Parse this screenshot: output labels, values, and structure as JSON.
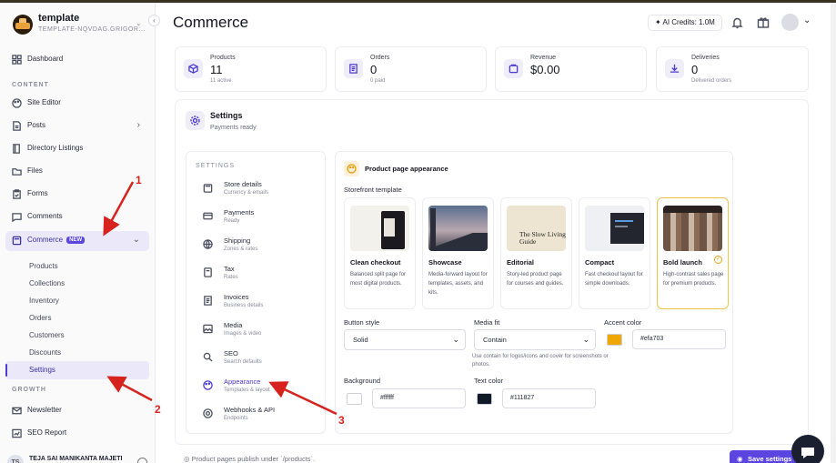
{
  "workspace": {
    "name": "template",
    "slug": "TEMPLATE-NQVDAG.GRIGOR..."
  },
  "sidebar": {
    "dashboard": "Dashboard",
    "section_content": "CONTENT",
    "site_editor": "Site Editor",
    "posts": "Posts",
    "directory": "Directory Listings",
    "files": "Files",
    "forms": "Forms",
    "comments": "Comments",
    "commerce": "Commerce",
    "commerce_badge": "NEW",
    "commerce_sub": [
      "Products",
      "Collections",
      "Inventory",
      "Orders",
      "Customers",
      "Discounts",
      "Settings"
    ],
    "section_growth": "GROWTH",
    "newsletter": "Newsletter",
    "seo_report": "SEO Report",
    "user_initials": "TS",
    "user_name": "TEJA SAI MANIKANTA MAJETI"
  },
  "header": {
    "title": "Commerce",
    "credits": "AI Credits: 1.0M"
  },
  "stats": [
    {
      "label": "Products",
      "value": "11",
      "sub": "11 active"
    },
    {
      "label": "Orders",
      "value": "0",
      "sub": "0 paid"
    },
    {
      "label": "Revenue",
      "value": "$0.00",
      "sub": ""
    },
    {
      "label": "Deliveries",
      "value": "0",
      "sub": "Delivered orders"
    }
  ],
  "settings": {
    "title": "Settings",
    "subtitle": "Payments ready",
    "nav_heading": "SETTINGS",
    "nav": [
      {
        "label": "Store details",
        "sub": "Currency & emails"
      },
      {
        "label": "Payments",
        "sub": "Ready"
      },
      {
        "label": "Shipping",
        "sub": "Zones & rates"
      },
      {
        "label": "Tax",
        "sub": "Rates"
      },
      {
        "label": "Invoices",
        "sub": "Business details"
      },
      {
        "label": "Media",
        "sub": "Images & video"
      },
      {
        "label": "SEO",
        "sub": "Search defaults"
      },
      {
        "label": "Appearance",
        "sub": "Templates & layout"
      },
      {
        "label": "Webhooks & API",
        "sub": "Endpoints"
      }
    ]
  },
  "appearance": {
    "title": "Product page appearance",
    "storefront_label": "Storefront template",
    "templates": [
      {
        "name": "Clean checkout",
        "desc": "Balanced split page for most digital products."
      },
      {
        "name": "Showcase",
        "desc": "Media-forward layout for templates, assets, and kits."
      },
      {
        "name": "Editorial",
        "desc": "Story-led product page for courses and guides.",
        "thumb_text": "The Slow Living Guide"
      },
      {
        "name": "Compact",
        "desc": "Fast checkout layout for simple downloads."
      },
      {
        "name": "Bold launch",
        "desc": "High-contrast sales page for premium products."
      }
    ],
    "selected_template": "Bold launch",
    "button_style_label": "Button style",
    "button_style_value": "Solid",
    "media_fit_label": "Media fit",
    "media_fit_value": "Contain",
    "media_fit_hint": "Use contain for logos/icons and cover for screenshots or photos.",
    "accent_label": "Accent color",
    "accent_value": "#efa703",
    "background_label": "Background",
    "background_value": "#ffffff",
    "text_color_label": "Text color",
    "text_color_value": "#111827"
  },
  "footer": {
    "note": "Product pages publish under `/products`.",
    "save": "Save settings"
  },
  "annotations": [
    "1",
    "2",
    "3"
  ],
  "colors": {
    "accent": "#5b45e0",
    "annotation": "#d6231e",
    "selected_border": "#f0c24a"
  }
}
